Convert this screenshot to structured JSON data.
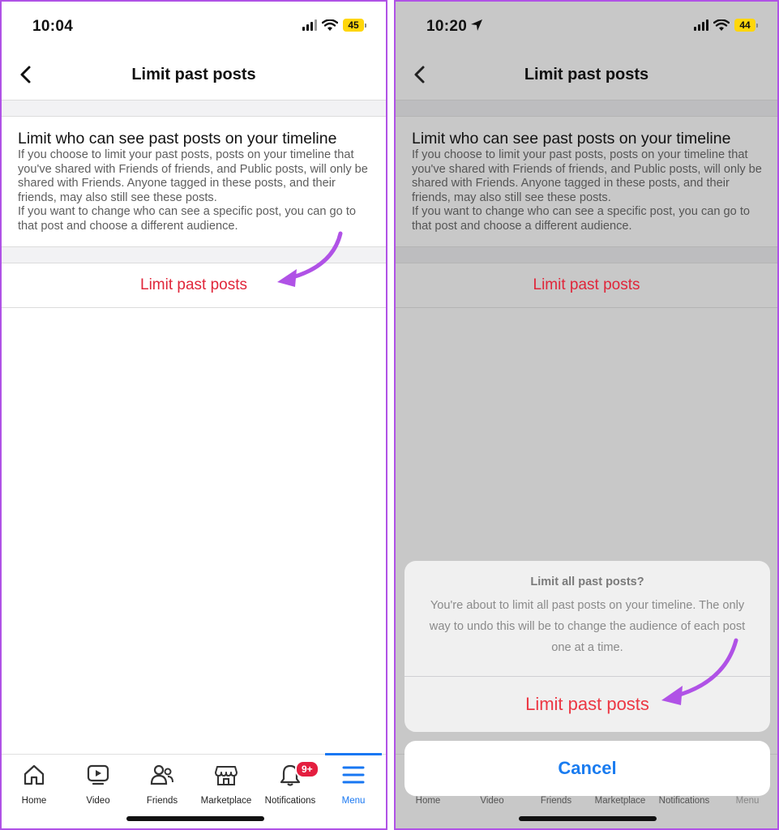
{
  "left_screen": {
    "status_bar": {
      "time": "10:04",
      "battery": "45"
    },
    "nav": {
      "title": "Limit past posts"
    },
    "section": {
      "title": "Limit who can see past posts on your timeline",
      "body_1": "If you choose to limit your past posts, posts on your timeline that you've shared with Friends of friends, and Public posts, will only be shared with Friends. Anyone tagged in these posts, and their friends, may also still see these posts.",
      "body_2": "If you want to change who can see a specific post, you can go to that post and choose a different audience."
    },
    "action_label": "Limit past posts",
    "tabs": [
      {
        "label": "Home",
        "icon": "home-icon"
      },
      {
        "label": "Video",
        "icon": "video-icon"
      },
      {
        "label": "Friends",
        "icon": "friends-icon"
      },
      {
        "label": "Marketplace",
        "icon": "marketplace-icon"
      },
      {
        "label": "Notifications",
        "icon": "bell-icon",
        "badge": "9+"
      },
      {
        "label": "Menu",
        "icon": "menu-icon"
      }
    ]
  },
  "right_screen": {
    "status_bar": {
      "time": "10:20",
      "battery": "44"
    },
    "nav": {
      "title": "Limit past posts"
    },
    "section": {
      "title": "Limit who can see past posts on your timeline",
      "body_1": "If you choose to limit your past posts, posts on your timeline that you've shared with Friends of friends, and Public posts, will only be shared with Friends. Anyone tagged in these posts, and their friends, may also still see these posts.",
      "body_2": "If you want to change who can see a specific post, you can go to that post and choose a different audience."
    },
    "action_label": "Limit past posts",
    "tabs": [
      {
        "label": "Home"
      },
      {
        "label": "Video"
      },
      {
        "label": "Friends"
      },
      {
        "label": "Marketplace"
      },
      {
        "label": "Notifications"
      },
      {
        "label": "Menu"
      }
    ],
    "action_sheet": {
      "title": "Limit all past posts?",
      "message": "You're about to limit all past posts on your timeline. The only way to undo this will be to change the audience of each post one at a time.",
      "confirm_label": "Limit past posts",
      "cancel_label": "Cancel"
    }
  },
  "colors": {
    "accent_blue": "#1877f2",
    "destructive_red": "#e0263a",
    "annotation_purple": "#b052e6",
    "battery_yellow": "#ffd60a"
  }
}
